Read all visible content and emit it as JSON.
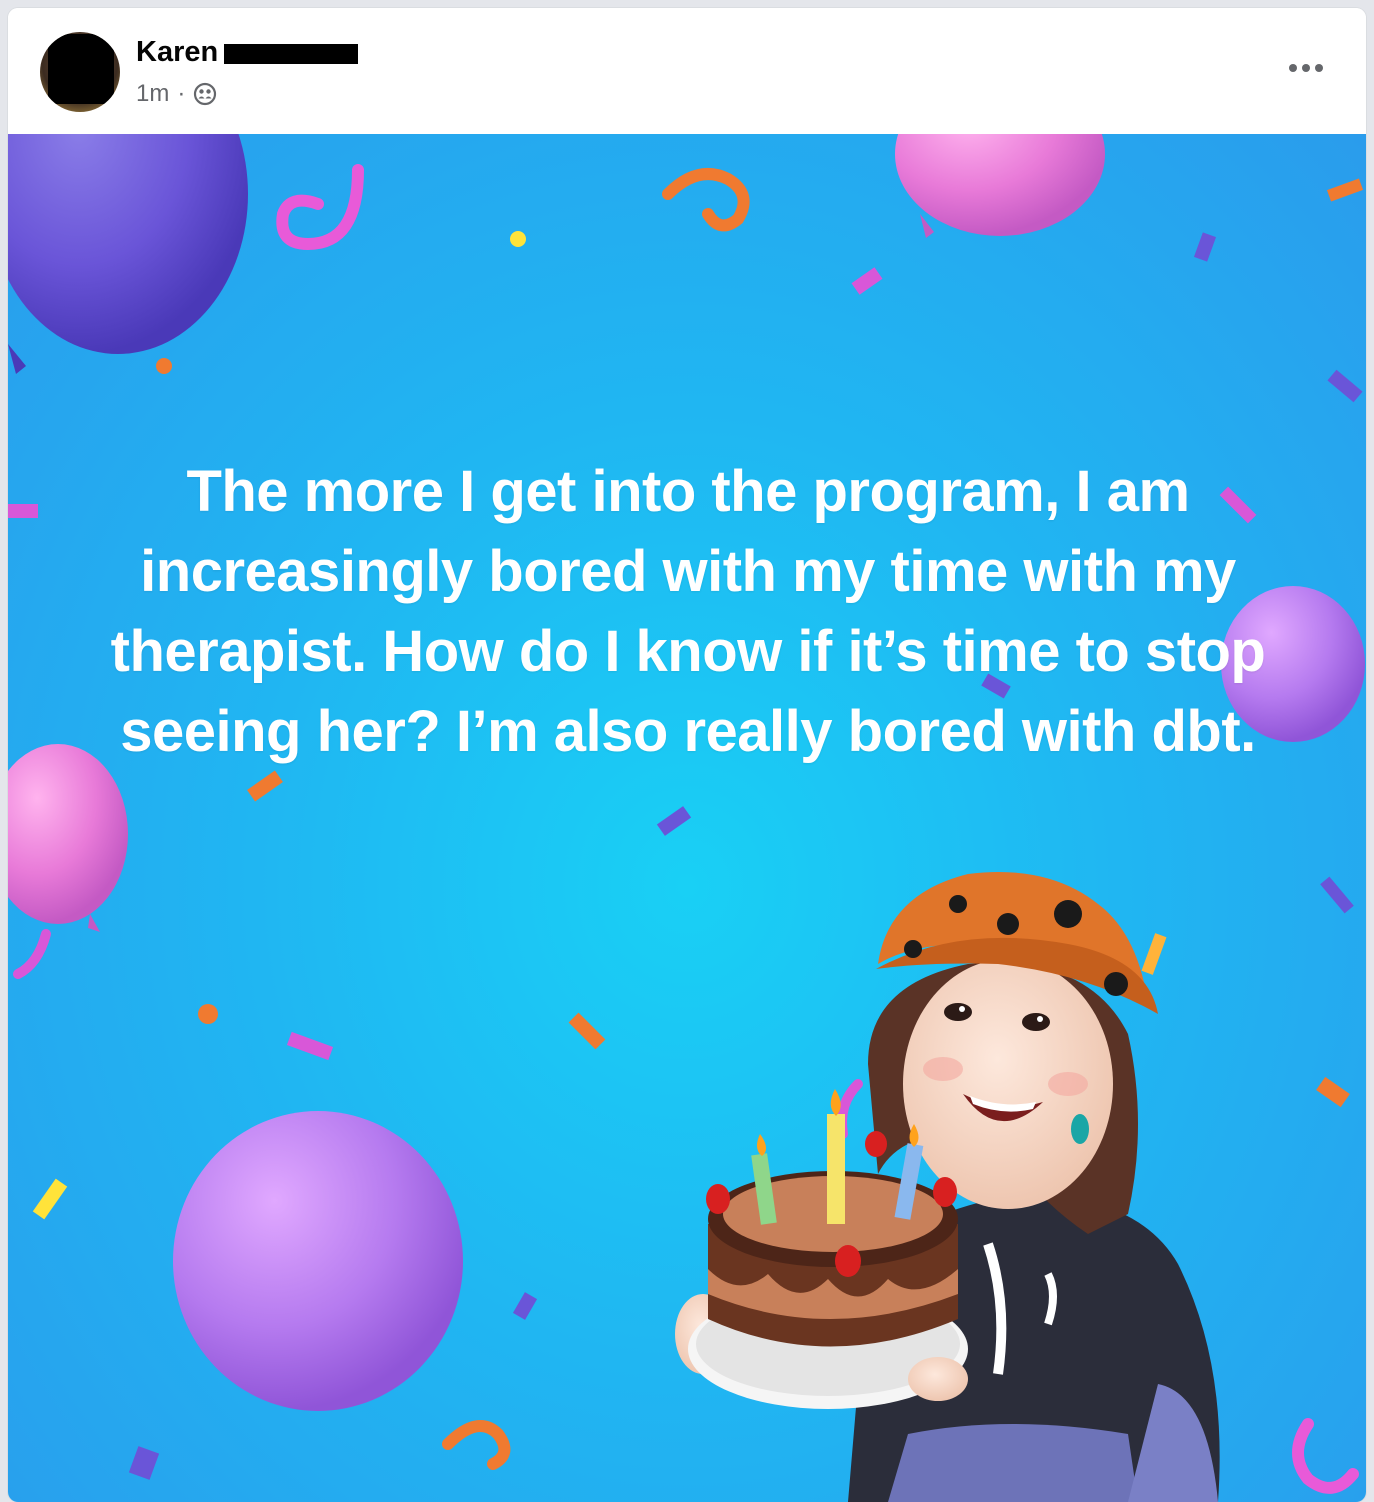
{
  "post": {
    "author_first_name": "Karen",
    "time_ago": "1m",
    "separator": "·",
    "audience_icon": "friends-icon",
    "more_icon": "more-horizontal-icon",
    "text": "The more I get into the program, I am increasingly bored with my time with my therapist. How do I know if it’s time to stop seeing her? I’m also really bored with dbt."
  },
  "media": {
    "theme": "birthday-celebration",
    "background_color": "#20b6f2",
    "elements": [
      "balloon",
      "confetti",
      "avatar-with-birthday-cake"
    ]
  }
}
